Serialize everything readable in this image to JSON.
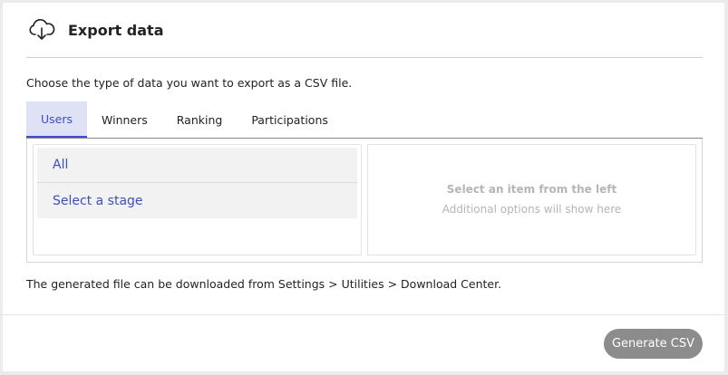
{
  "dialog": {
    "title": "Export data",
    "icon": "cloud-download-icon",
    "description": "Choose the type of data you want to export as a CSV file.",
    "tabs": [
      {
        "label": "Users",
        "active": true
      },
      {
        "label": "Winners",
        "active": false
      },
      {
        "label": "Ranking",
        "active": false
      },
      {
        "label": "Participations",
        "active": false
      }
    ],
    "options": [
      {
        "label": "All"
      },
      {
        "label": "Select a stage"
      }
    ],
    "details": {
      "title": "Select an item from the left",
      "subtitle": "Additional options will show here"
    },
    "footnote": "The generated file can be downloaded from Settings > Utilities > Download Center.",
    "generate_label": "Generate CSV"
  },
  "colors": {
    "accent": "#3d4fbf",
    "active_tab_bg": "#dfe1f5",
    "button_bg": "#8c8c8c",
    "hint_text": "#b5b5b5"
  }
}
